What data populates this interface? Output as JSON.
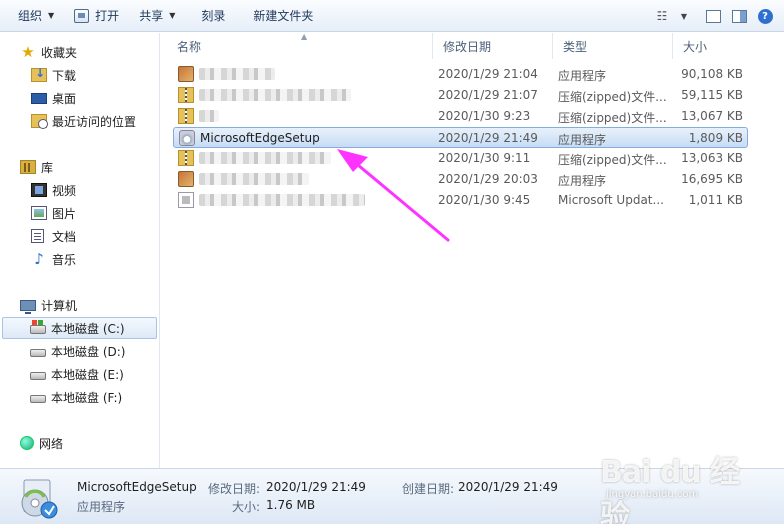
{
  "toolbar": {
    "organize": "组织",
    "open": "打开",
    "share": "共享",
    "burn": "刻录",
    "new_folder": "新建文件夹"
  },
  "sidebar": {
    "favorites": "收藏夹",
    "downloads": "下载",
    "desktop": "桌面",
    "recent": "最近访问的位置",
    "libraries": "库",
    "videos": "视频",
    "pictures": "图片",
    "documents": "文档",
    "music": "音乐",
    "computer": "计算机",
    "drive_c": "本地磁盘 (C:)",
    "drive_d": "本地磁盘 (D:)",
    "drive_e": "本地磁盘 (E:)",
    "drive_f": "本地磁盘 (F:)",
    "network": "网络"
  },
  "columns": {
    "name": "名称",
    "modified": "修改日期",
    "type": "类型",
    "size": "大小"
  },
  "files": [
    {
      "name": "",
      "modified": "2020/1/29 21:04",
      "type": "应用程序",
      "size": "90,108 KB",
      "icon": "exe-icon"
    },
    {
      "name": "",
      "modified": "2020/1/29 21:07",
      "type": "压缩(zipped)文件...",
      "size": "59,115 KB",
      "icon": "zip-icon"
    },
    {
      "name": "",
      "modified": "2020/1/30 9:23",
      "type": "压缩(zipped)文件...",
      "size": "13,067 KB",
      "icon": "zip-icon"
    },
    {
      "name": "MicrosoftEdgeSetup",
      "modified": "2020/1/29 21:49",
      "type": "应用程序",
      "size": "1,809 KB",
      "icon": "setup-icon"
    },
    {
      "name": "",
      "modified": "2020/1/30 9:11",
      "type": "压缩(zipped)文件...",
      "size": "13,063 KB",
      "icon": "zip-icon"
    },
    {
      "name": "",
      "modified": "2020/1/29 20:03",
      "type": "应用程序",
      "size": "16,695 KB",
      "icon": "exe-icon"
    },
    {
      "name": "",
      "modified": "2020/1/30 9:45",
      "type": "Microsoft Updat...",
      "size": "1,011 KB",
      "icon": "msu-icon"
    }
  ],
  "details": {
    "file_name": "MicrosoftEdgeSetup",
    "file_type": "应用程序",
    "modified_label": "修改日期:",
    "modified_value": "2020/1/29 21:49",
    "size_label": "大小:",
    "size_value": "1.76 MB",
    "created_label": "创建日期:",
    "created_value": "2020/1/29 21:49"
  },
  "watermark": {
    "main": "Bai du 经验",
    "sub": "jingyan.baidu.com"
  },
  "colors": {
    "selection": "#c6dcf5",
    "annotation_arrow": "#ff33ff"
  }
}
